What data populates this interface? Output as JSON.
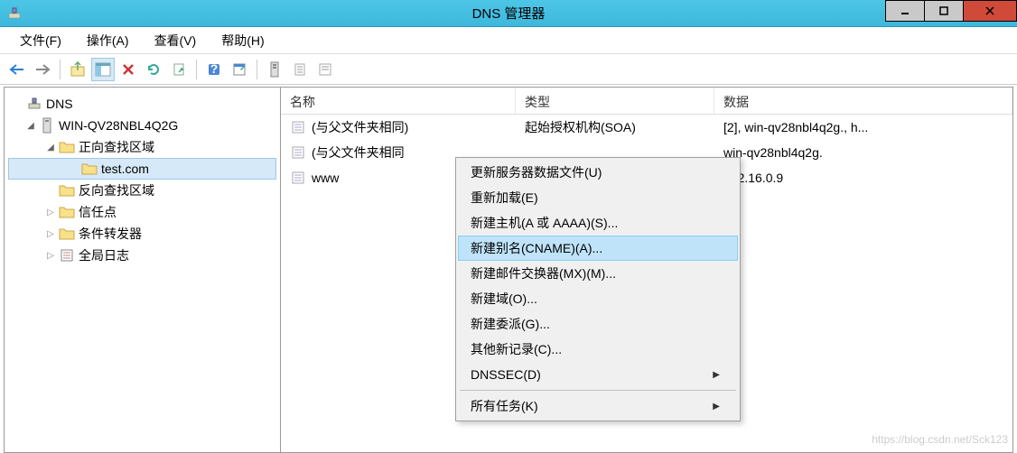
{
  "titlebar": {
    "title": "DNS 管理器"
  },
  "menubar": {
    "file": "文件(F)",
    "action": "操作(A)",
    "view": "查看(V)",
    "help": "帮助(H)"
  },
  "tree": {
    "root": "DNS",
    "server": "WIN-QV28NBL4Q2G",
    "forward": "正向查找区域",
    "zone": "test.com",
    "reverse": "反向查找区域",
    "trust": "信任点",
    "conditional": "条件转发器",
    "global": "全局日志"
  },
  "list": {
    "header": {
      "name": "名称",
      "type": "类型",
      "data": "数据"
    },
    "rows": [
      {
        "name": "(与父文件夹相同)",
        "type": "起始授权机构(SOA)",
        "data": "[2], win-qv28nbl4q2g., h..."
      },
      {
        "name": "(与父文件夹相同",
        "type": "",
        "data": "win-qv28nbl4q2g."
      },
      {
        "name": "www",
        "type": "",
        "data": "172.16.0.9"
      }
    ]
  },
  "contextmenu": {
    "update": "更新服务器数据文件(U)",
    "reload": "重新加载(E)",
    "newhost": "新建主机(A 或 AAAA)(S)...",
    "newalias": "新建别名(CNAME)(A)...",
    "newmx": "新建邮件交换器(MX)(M)...",
    "newdomain": "新建域(O)...",
    "newdelegation": "新建委派(G)...",
    "other": "其他新记录(C)...",
    "dnssec": "DNSSEC(D)",
    "alltasks": "所有任务(K)"
  },
  "watermark": "https://blog.csdn.net/Sck123"
}
